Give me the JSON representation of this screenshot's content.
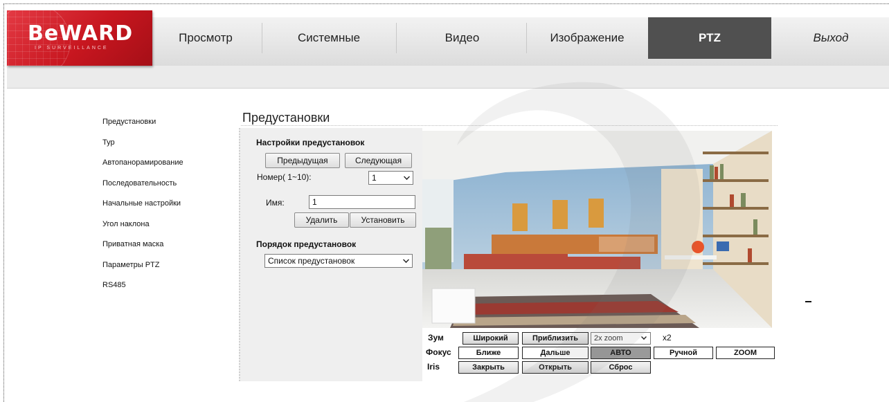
{
  "brand": {
    "logo_text": "BeWARD",
    "logo_sub": "IP SURVEILLANCE"
  },
  "nav": {
    "items": [
      {
        "label": "Просмотр"
      },
      {
        "label": "Системные"
      },
      {
        "label": "Видео"
      },
      {
        "label": "Изображение"
      },
      {
        "label": "PTZ",
        "active": true
      },
      {
        "label": "Выход"
      }
    ]
  },
  "sidebar": {
    "items": [
      {
        "label": "Предустановки"
      },
      {
        "label": "Тур"
      },
      {
        "label": "Автопанорамирование"
      },
      {
        "label": "Последовательность"
      },
      {
        "label": "Начальные настройки"
      },
      {
        "label": "Угол наклона"
      },
      {
        "label": "Приватная маска"
      },
      {
        "label": "Параметры PTZ"
      },
      {
        "label": "RS485"
      }
    ]
  },
  "page": {
    "title": "Предустановки"
  },
  "presets": {
    "section_title": "Настройки предустановок",
    "prev_button": "Предыдущая",
    "next_button": "Следующая",
    "number_label": "Номер( 1~10):",
    "number_value": "1",
    "name_label": "Имя:",
    "name_value": "1",
    "delete_button": "Удалить",
    "set_button": "Установить",
    "order_title": "Порядок предустановок",
    "order_value": "Список предустановок"
  },
  "controls": {
    "zoom": {
      "label": "Зум",
      "wide": "Широкий",
      "tele": "Приблизить",
      "select_value": "2x zoom",
      "factor": "x2"
    },
    "focus": {
      "label": "Фокус",
      "near": "Ближе",
      "far": "Дальше",
      "auto": "АВТО",
      "manual": "Ручной",
      "zoom": "ZOOM"
    },
    "iris": {
      "label": "Iris",
      "close": "Закрыть",
      "open": "Открыть",
      "reset": "Сброс"
    }
  },
  "colors": {
    "brand_red": "#c7161f",
    "active_tab": "#505050",
    "panel_bg": "#efefef"
  }
}
